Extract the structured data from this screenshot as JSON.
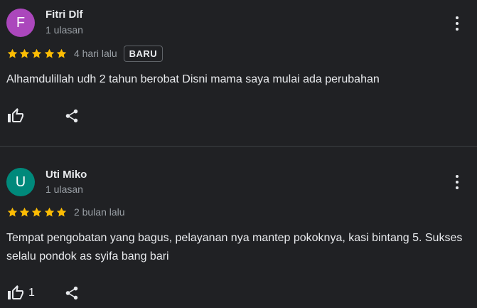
{
  "reviews": [
    {
      "avatar_letter": "F",
      "avatar_color": "#ab47bc",
      "name": "Fitri Dlf",
      "review_count": "1 ulasan",
      "rating": 5,
      "date": "4 hari lalu",
      "badge": "BARU",
      "text": "Alhamdulillah udh 2 tahun berobat Disni mama saya mulai ada perubahan",
      "like_count": ""
    },
    {
      "avatar_letter": "U",
      "avatar_color": "#00897b",
      "name": "Uti Miko",
      "review_count": "1 ulasan",
      "rating": 5,
      "date": "2 bulan lalu",
      "badge": "",
      "text": "Tempat pengobatan yang bagus, pelayanan nya mantep pokoknya, kasi bintang 5. Sukses selalu pondok as syifa bang bari",
      "like_count": "1"
    }
  ],
  "colors": {
    "background": "#202124",
    "star": "#fbbc04",
    "text": "#e8eaed",
    "muted": "#9aa0a6"
  },
  "icons": [
    "thumb-up-icon",
    "share-icon",
    "more-vert-icon",
    "star-icon"
  ]
}
